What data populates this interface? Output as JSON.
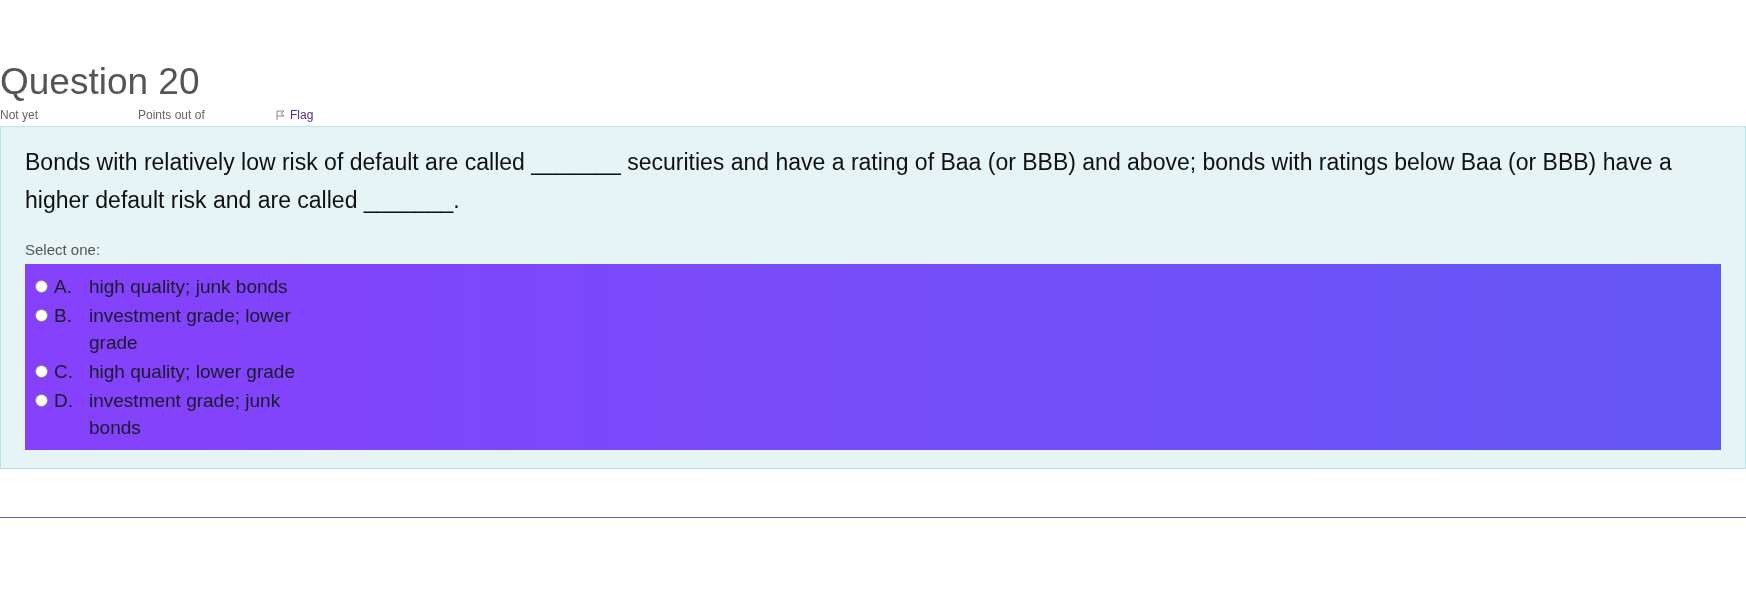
{
  "question": {
    "title": "Question 20",
    "status": "Not yet",
    "points": "Points out of",
    "flag": "Flag",
    "text": "Bonds with relatively low risk of default are called _______ securities and have a rating of Baa (or BBB) and above; bonds with ratings below Baa (or BBB) have a higher default risk and are called _______.",
    "prompt": "Select one:",
    "options": [
      {
        "letter": "A.",
        "text": "high quality; junk bonds",
        "selected": false
      },
      {
        "letter": "B.",
        "text": "investment grade; lower grade",
        "selected": false
      },
      {
        "letter": "C.",
        "text": "high quality; lower grade",
        "selected": false
      },
      {
        "letter": "D.",
        "text": "investment grade; junk bonds",
        "selected": false
      }
    ]
  }
}
